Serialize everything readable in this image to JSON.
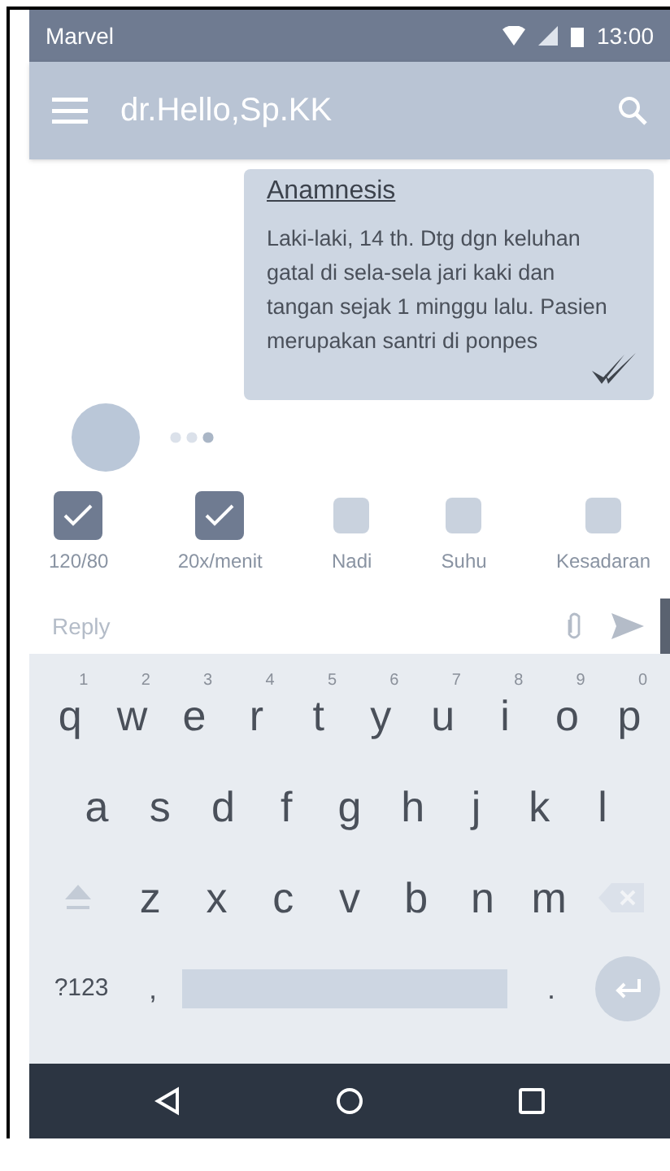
{
  "status_bar": {
    "carrier": "Marvel",
    "time": "13:00"
  },
  "app_bar": {
    "title": "dr.Hello,Sp.KK"
  },
  "message": {
    "title": "Anamnesis",
    "body": "Laki-laki, 14 th. Dtg dgn keluhan gatal di sela-sela jari kaki dan tangan sejak 1 minggu lalu. Pasien merupakan santri di ponpes"
  },
  "vitals": [
    {
      "label": "120/80",
      "checked": true
    },
    {
      "label": "20x/menit",
      "checked": true
    },
    {
      "label": "Nadi",
      "checked": false
    },
    {
      "label": "Suhu",
      "checked": false
    },
    {
      "label": "Kesadaran",
      "checked": false
    }
  ],
  "reply": {
    "placeholder": "Reply"
  },
  "keyboard": {
    "rows": [
      [
        {
          "key": "q",
          "hint": "1"
        },
        {
          "key": "w",
          "hint": "2"
        },
        {
          "key": "e",
          "hint": "3"
        },
        {
          "key": "r",
          "hint": "4"
        },
        {
          "key": "t",
          "hint": "5"
        },
        {
          "key": "y",
          "hint": "6"
        },
        {
          "key": "u",
          "hint": "7"
        },
        {
          "key": "i",
          "hint": "8"
        },
        {
          "key": "o",
          "hint": "9"
        },
        {
          "key": "p",
          "hint": "0"
        }
      ],
      [
        {
          "key": "a"
        },
        {
          "key": "s"
        },
        {
          "key": "d"
        },
        {
          "key": "f"
        },
        {
          "key": "g"
        },
        {
          "key": "h"
        },
        {
          "key": "j"
        },
        {
          "key": "k"
        },
        {
          "key": "l"
        }
      ],
      [
        {
          "key": "z"
        },
        {
          "key": "x"
        },
        {
          "key": "c"
        },
        {
          "key": "v"
        },
        {
          "key": "b"
        },
        {
          "key": "n"
        },
        {
          "key": "m"
        }
      ]
    ],
    "symbols": "?123",
    "comma": ",",
    "period": "."
  }
}
